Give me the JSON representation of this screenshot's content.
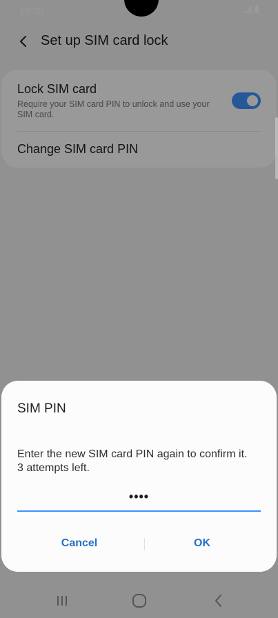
{
  "status_bar": {
    "time": "10:00"
  },
  "header": {
    "title": "Set up SIM card lock"
  },
  "settings": {
    "lock_sim": {
      "title": "Lock SIM card",
      "subtitle": "Require your SIM card PIN to unlock and use your SIM card.",
      "enabled": true
    },
    "change_pin": {
      "title": "Change SIM card PIN"
    }
  },
  "dialog": {
    "title": "SIM PIN",
    "message_line1": "Enter the new SIM card PIN again to confirm it.",
    "message_line2": "3 attempts left.",
    "pin_value": "••••",
    "cancel_label": "Cancel",
    "ok_label": "OK"
  },
  "colors": {
    "accent": "#3e91ff",
    "button_text": "#2570c8",
    "scrim": "rgba(0,0,0,0.4)"
  },
  "icons": {
    "back": "chevron-left-icon",
    "recents": "recents-icon",
    "home": "home-icon",
    "nav_back": "nav-back-icon"
  }
}
